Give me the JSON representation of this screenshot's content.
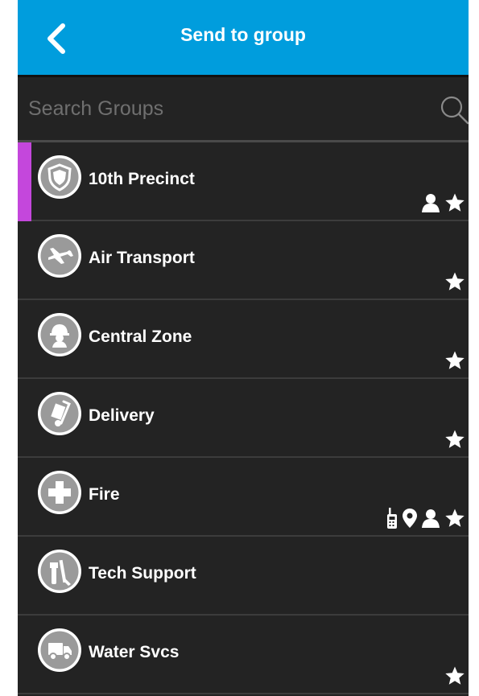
{
  "header": {
    "title": "Send to group",
    "back_icon": "chevron-left-icon"
  },
  "search": {
    "placeholder": "Search Groups",
    "value": "",
    "icon": "search-icon"
  },
  "colors": {
    "header": "#009ddd",
    "background": "#232323",
    "selection": "#c447dc"
  },
  "groups": [
    {
      "name": "10th Precinct",
      "icon": "shield-badge-icon",
      "selected": true,
      "indicators": [
        "person-icon",
        "star-icon"
      ]
    },
    {
      "name": "Air Transport",
      "icon": "airplane-icon",
      "selected": false,
      "indicators": [
        "star-icon"
      ]
    },
    {
      "name": "Central Zone",
      "icon": "hard-hat-worker-icon",
      "selected": false,
      "indicators": [
        "star-icon"
      ]
    },
    {
      "name": "Delivery",
      "icon": "hand-truck-icon",
      "selected": false,
      "indicators": [
        "star-icon"
      ]
    },
    {
      "name": "Fire",
      "icon": "medical-cross-icon",
      "selected": false,
      "indicators": [
        "radio-icon",
        "location-pin-icon",
        "person-icon",
        "star-icon"
      ]
    },
    {
      "name": "Tech Support",
      "icon": "tools-icon",
      "selected": false,
      "indicators": []
    },
    {
      "name": "Water Svcs",
      "icon": "truck-icon",
      "selected": false,
      "indicators": [
        "star-icon"
      ]
    }
  ]
}
